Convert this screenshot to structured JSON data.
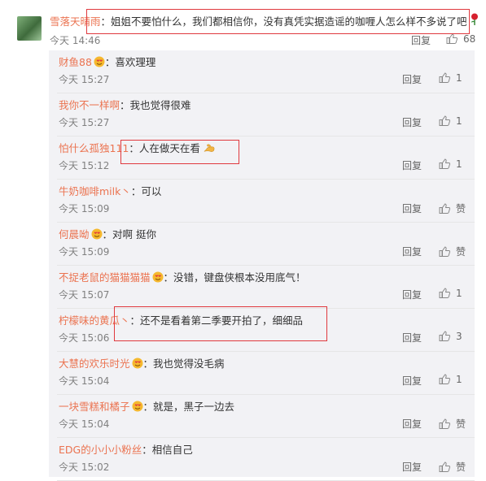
{
  "comment": {
    "username": "雪落天晴雨",
    "text": "：姐姐不要怕什么，我们都相信你，没有真凭实据造谣的咖喱人怎么样不多说了吧",
    "time": "今天 14:46",
    "reply_label": "回复",
    "like_count": "68"
  },
  "replies": [
    {
      "username": "财鱼88",
      "text": "：喜欢理理",
      "time": "今天 15:27",
      "reply_label": "回复",
      "like_label": "1"
    },
    {
      "username": "我你不一样啊",
      "text": "：我也觉得很难",
      "time": "今天 15:27",
      "reply_label": "回复",
      "like_label": "1"
    },
    {
      "username": "怕什么孤独111",
      "text": "：人在做天在看",
      "time": "今天 15:12",
      "reply_label": "回复",
      "like_label": "1"
    },
    {
      "username": "牛奶咖啡milk丶",
      "text": "：可以",
      "time": "今天 15:09",
      "reply_label": "回复",
      "like_label": "赞"
    },
    {
      "username": "何晨呦",
      "text": "：对啊 挺你",
      "time": "今天 15:09",
      "reply_label": "回复",
      "like_label": "赞"
    },
    {
      "username": "不捉老鼠的猫猫猫猫",
      "text": "：没错，键盘侠根本没用底气！",
      "time": "今天 15:07",
      "reply_label": "回复",
      "like_label": "1"
    },
    {
      "username": "柠檬味的黄瓜丶",
      "text": "：还不是看着第二季要开拍了，细细品",
      "time": "今天 15:06",
      "reply_label": "回复",
      "like_label": "3"
    },
    {
      "username": "大慧的欢乐时光",
      "text": "：我也觉得没毛病",
      "time": "今天 15:04",
      "reply_label": "回复",
      "like_label": "1"
    },
    {
      "username": "一块雪糕和橘子",
      "text": "：就是，黑子一边去",
      "time": "今天 15:04",
      "reply_label": "回复",
      "like_label": "赞"
    },
    {
      "username": "EDG的小小小粉丝",
      "text": "：相信自己",
      "time": "今天 15:02",
      "reply_label": "回复",
      "like_label": "赞"
    }
  ],
  "icons": {
    "like": "thumbs-up-icon",
    "badge": "heart-eyes-emoji",
    "flex": "flexed-biceps-emoji",
    "rose": "rose-emoji"
  },
  "colors": {
    "username": "#eb7350",
    "highlight_box": "#e0393e",
    "reply_bg": "#f2f2f5"
  }
}
